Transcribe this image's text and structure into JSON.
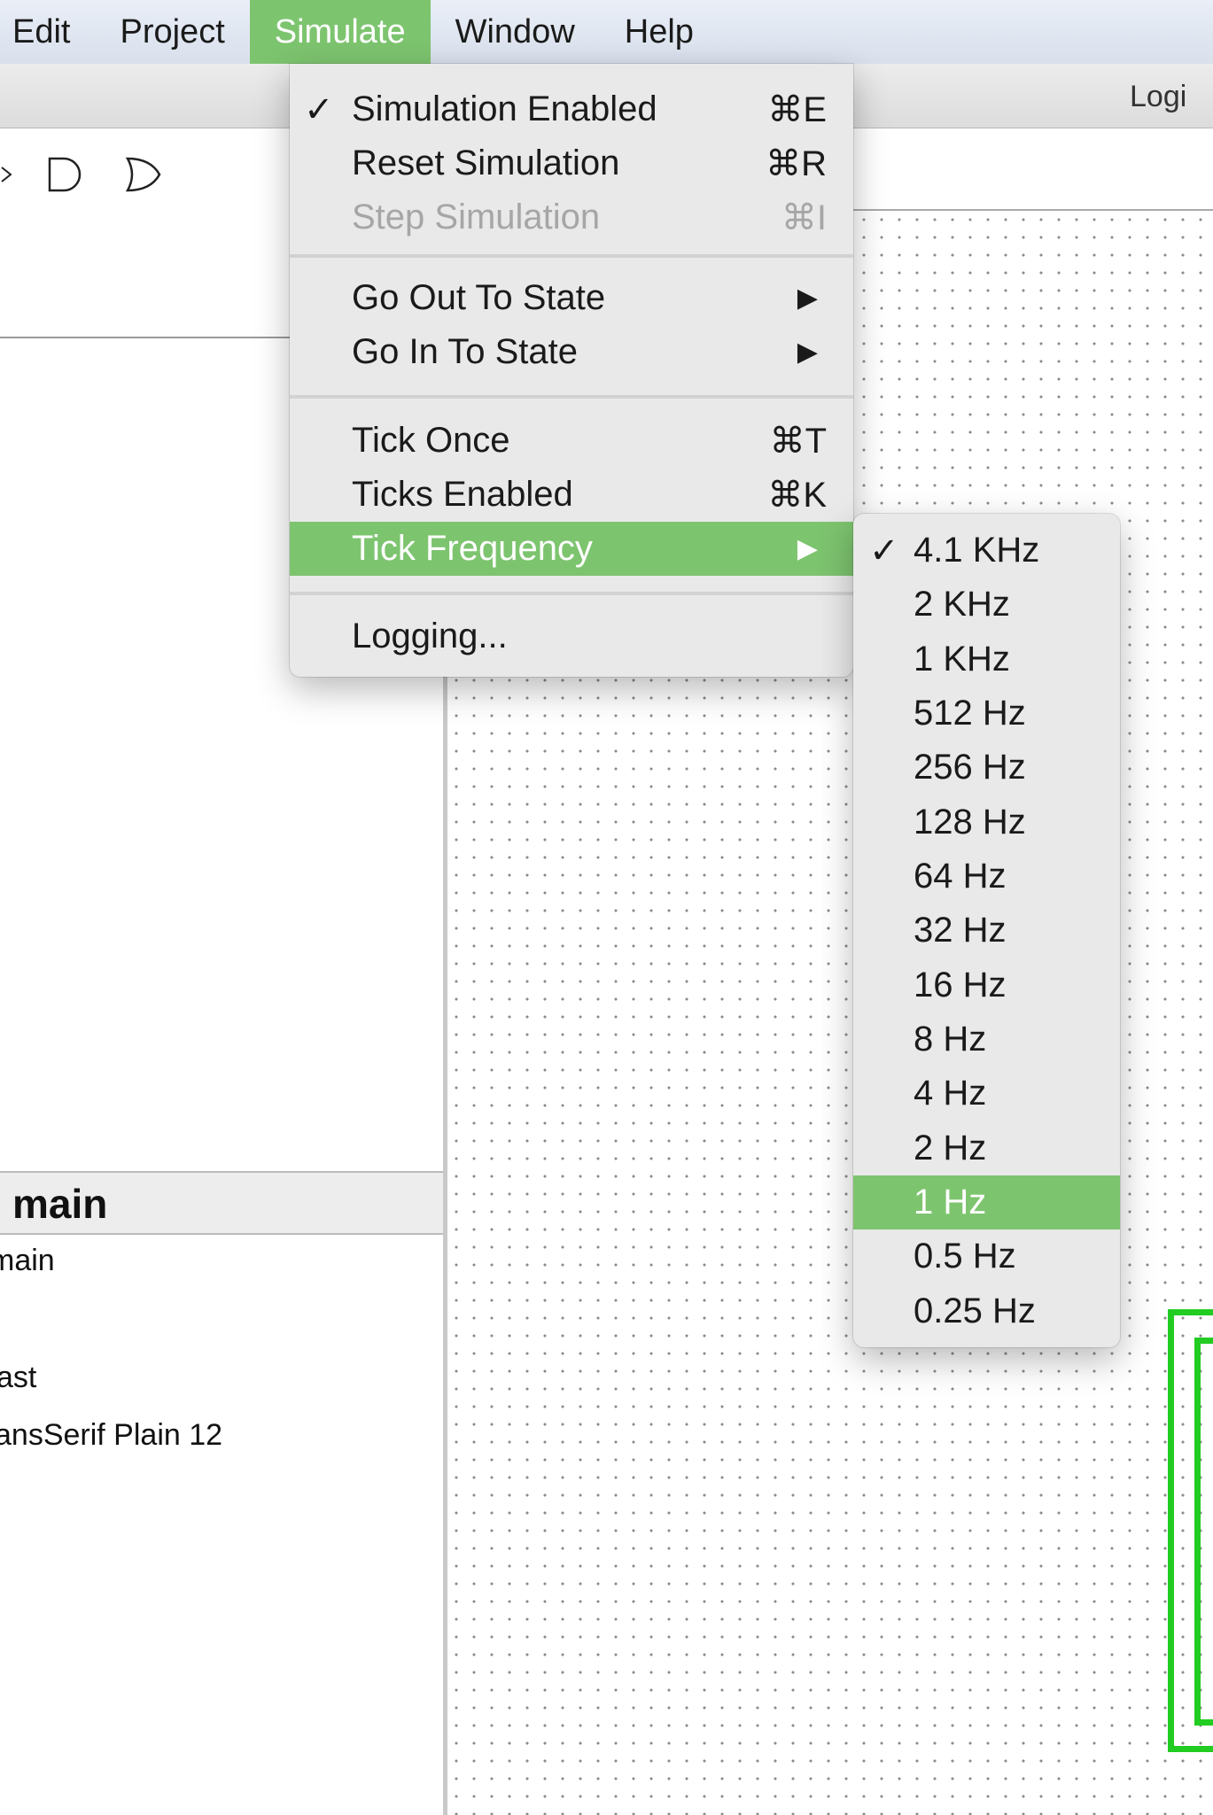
{
  "menubar": {
    "items": [
      "Edit",
      "Project",
      "Simulate",
      "Window",
      "Help"
    ],
    "active": "Simulate"
  },
  "window": {
    "title": "Logi"
  },
  "toolbar": {
    "gate_icons": [
      "buffer-icon",
      "and-gate-icon",
      "or-gate-icon"
    ]
  },
  "attributes": {
    "header": "main",
    "rows": [
      "main",
      "",
      "ast",
      "ansSerif Plain 12"
    ]
  },
  "simulate_menu": {
    "groups": [
      [
        {
          "label": "Simulation Enabled",
          "shortcut": "⌘E",
          "checked": true,
          "enabled": true
        },
        {
          "label": "Reset Simulation",
          "shortcut": "⌘R",
          "checked": false,
          "enabled": true
        },
        {
          "label": "Step Simulation",
          "shortcut": "⌘I",
          "checked": false,
          "enabled": false
        }
      ],
      [
        {
          "label": "Go Out To State",
          "submenu": true
        },
        {
          "label": "Go In To State",
          "submenu": true
        }
      ],
      [
        {
          "label": "Tick Once",
          "shortcut": "⌘T"
        },
        {
          "label": "Ticks Enabled",
          "shortcut": "⌘K"
        },
        {
          "label": "Tick Frequency",
          "submenu": true,
          "highlighted": true
        }
      ],
      [
        {
          "label": "Logging..."
        }
      ]
    ],
    "check_mark": "✓",
    "submenu_arrow": "▶"
  },
  "tick_frequency_menu": {
    "items": [
      "4.1 KHz",
      "2 KHz",
      "1 KHz",
      "512 Hz",
      "256 Hz",
      "128 Hz",
      "64 Hz",
      "32 Hz",
      "16 Hz",
      "8 Hz",
      "4 Hz",
      "2 Hz",
      "1 Hz",
      "0.5 Hz",
      "0.25 Hz"
    ],
    "checked": "4.1 KHz",
    "highlighted": "1 Hz"
  },
  "colors": {
    "menu_highlight": "#7dc46f",
    "wire_green": "#22cc22",
    "menu_background": "#e9e9e9",
    "disabled_text": "#a6a6a6"
  }
}
